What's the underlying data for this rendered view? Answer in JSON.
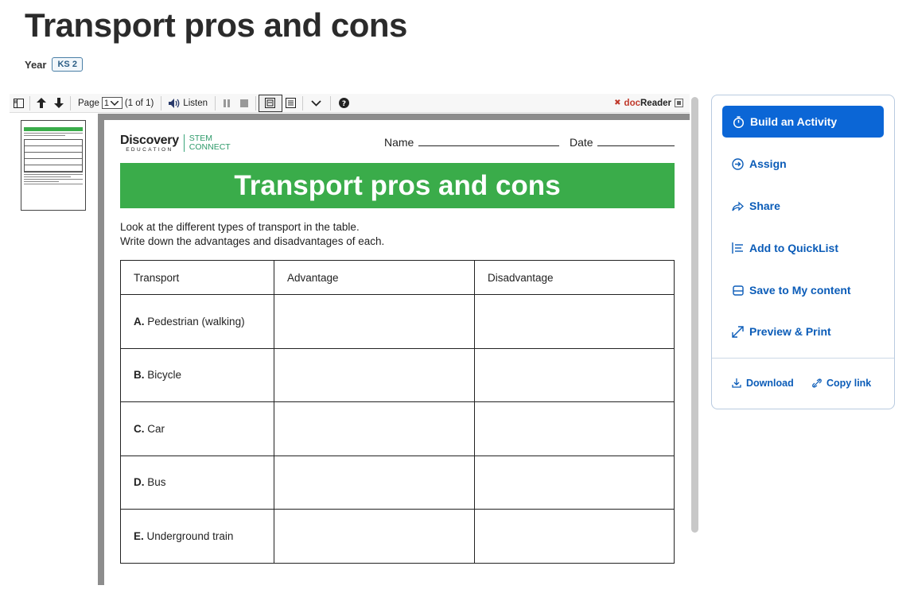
{
  "page": {
    "title": "Transport pros and cons",
    "year_label": "Year",
    "year_badge": "KS 2"
  },
  "toolbar": {
    "page_label": "Page",
    "page_value": "1",
    "page_count": "(1 of 1)",
    "listen_label": "Listen",
    "brand_prefix": "doc",
    "brand_suffix": "Reader"
  },
  "worksheet": {
    "logo_main": "Discovery",
    "logo_sub": "EDUCATION",
    "logo_stem_1": "STEM",
    "logo_stem_2": "CONNECT",
    "name_label": "Name",
    "date_label": "Date",
    "banner": "Transport pros and cons",
    "instructions_1": "Look at the different types of transport in the table.",
    "instructions_2": "Write down the advantages and disadvantages of each.",
    "headers": [
      "Transport",
      "Advantage",
      "Disadvantage"
    ],
    "rows": [
      {
        "letter": "A.",
        "label": "Pedestrian (walking)"
      },
      {
        "letter": "B.",
        "label": "Bicycle"
      },
      {
        "letter": "C.",
        "label": "Car"
      },
      {
        "letter": "D.",
        "label": "Bus"
      },
      {
        "letter": "E.",
        "label": "Underground train"
      }
    ]
  },
  "actions": {
    "build": "Build an Activity",
    "assign": "Assign",
    "share": "Share",
    "quicklist": "Add to QuickList",
    "save": "Save to My content",
    "preview": "Preview & Print",
    "download": "Download",
    "copy_link": "Copy link"
  },
  "colors": {
    "accent": "#0b66d6",
    "banner_green": "#3aac4a"
  }
}
